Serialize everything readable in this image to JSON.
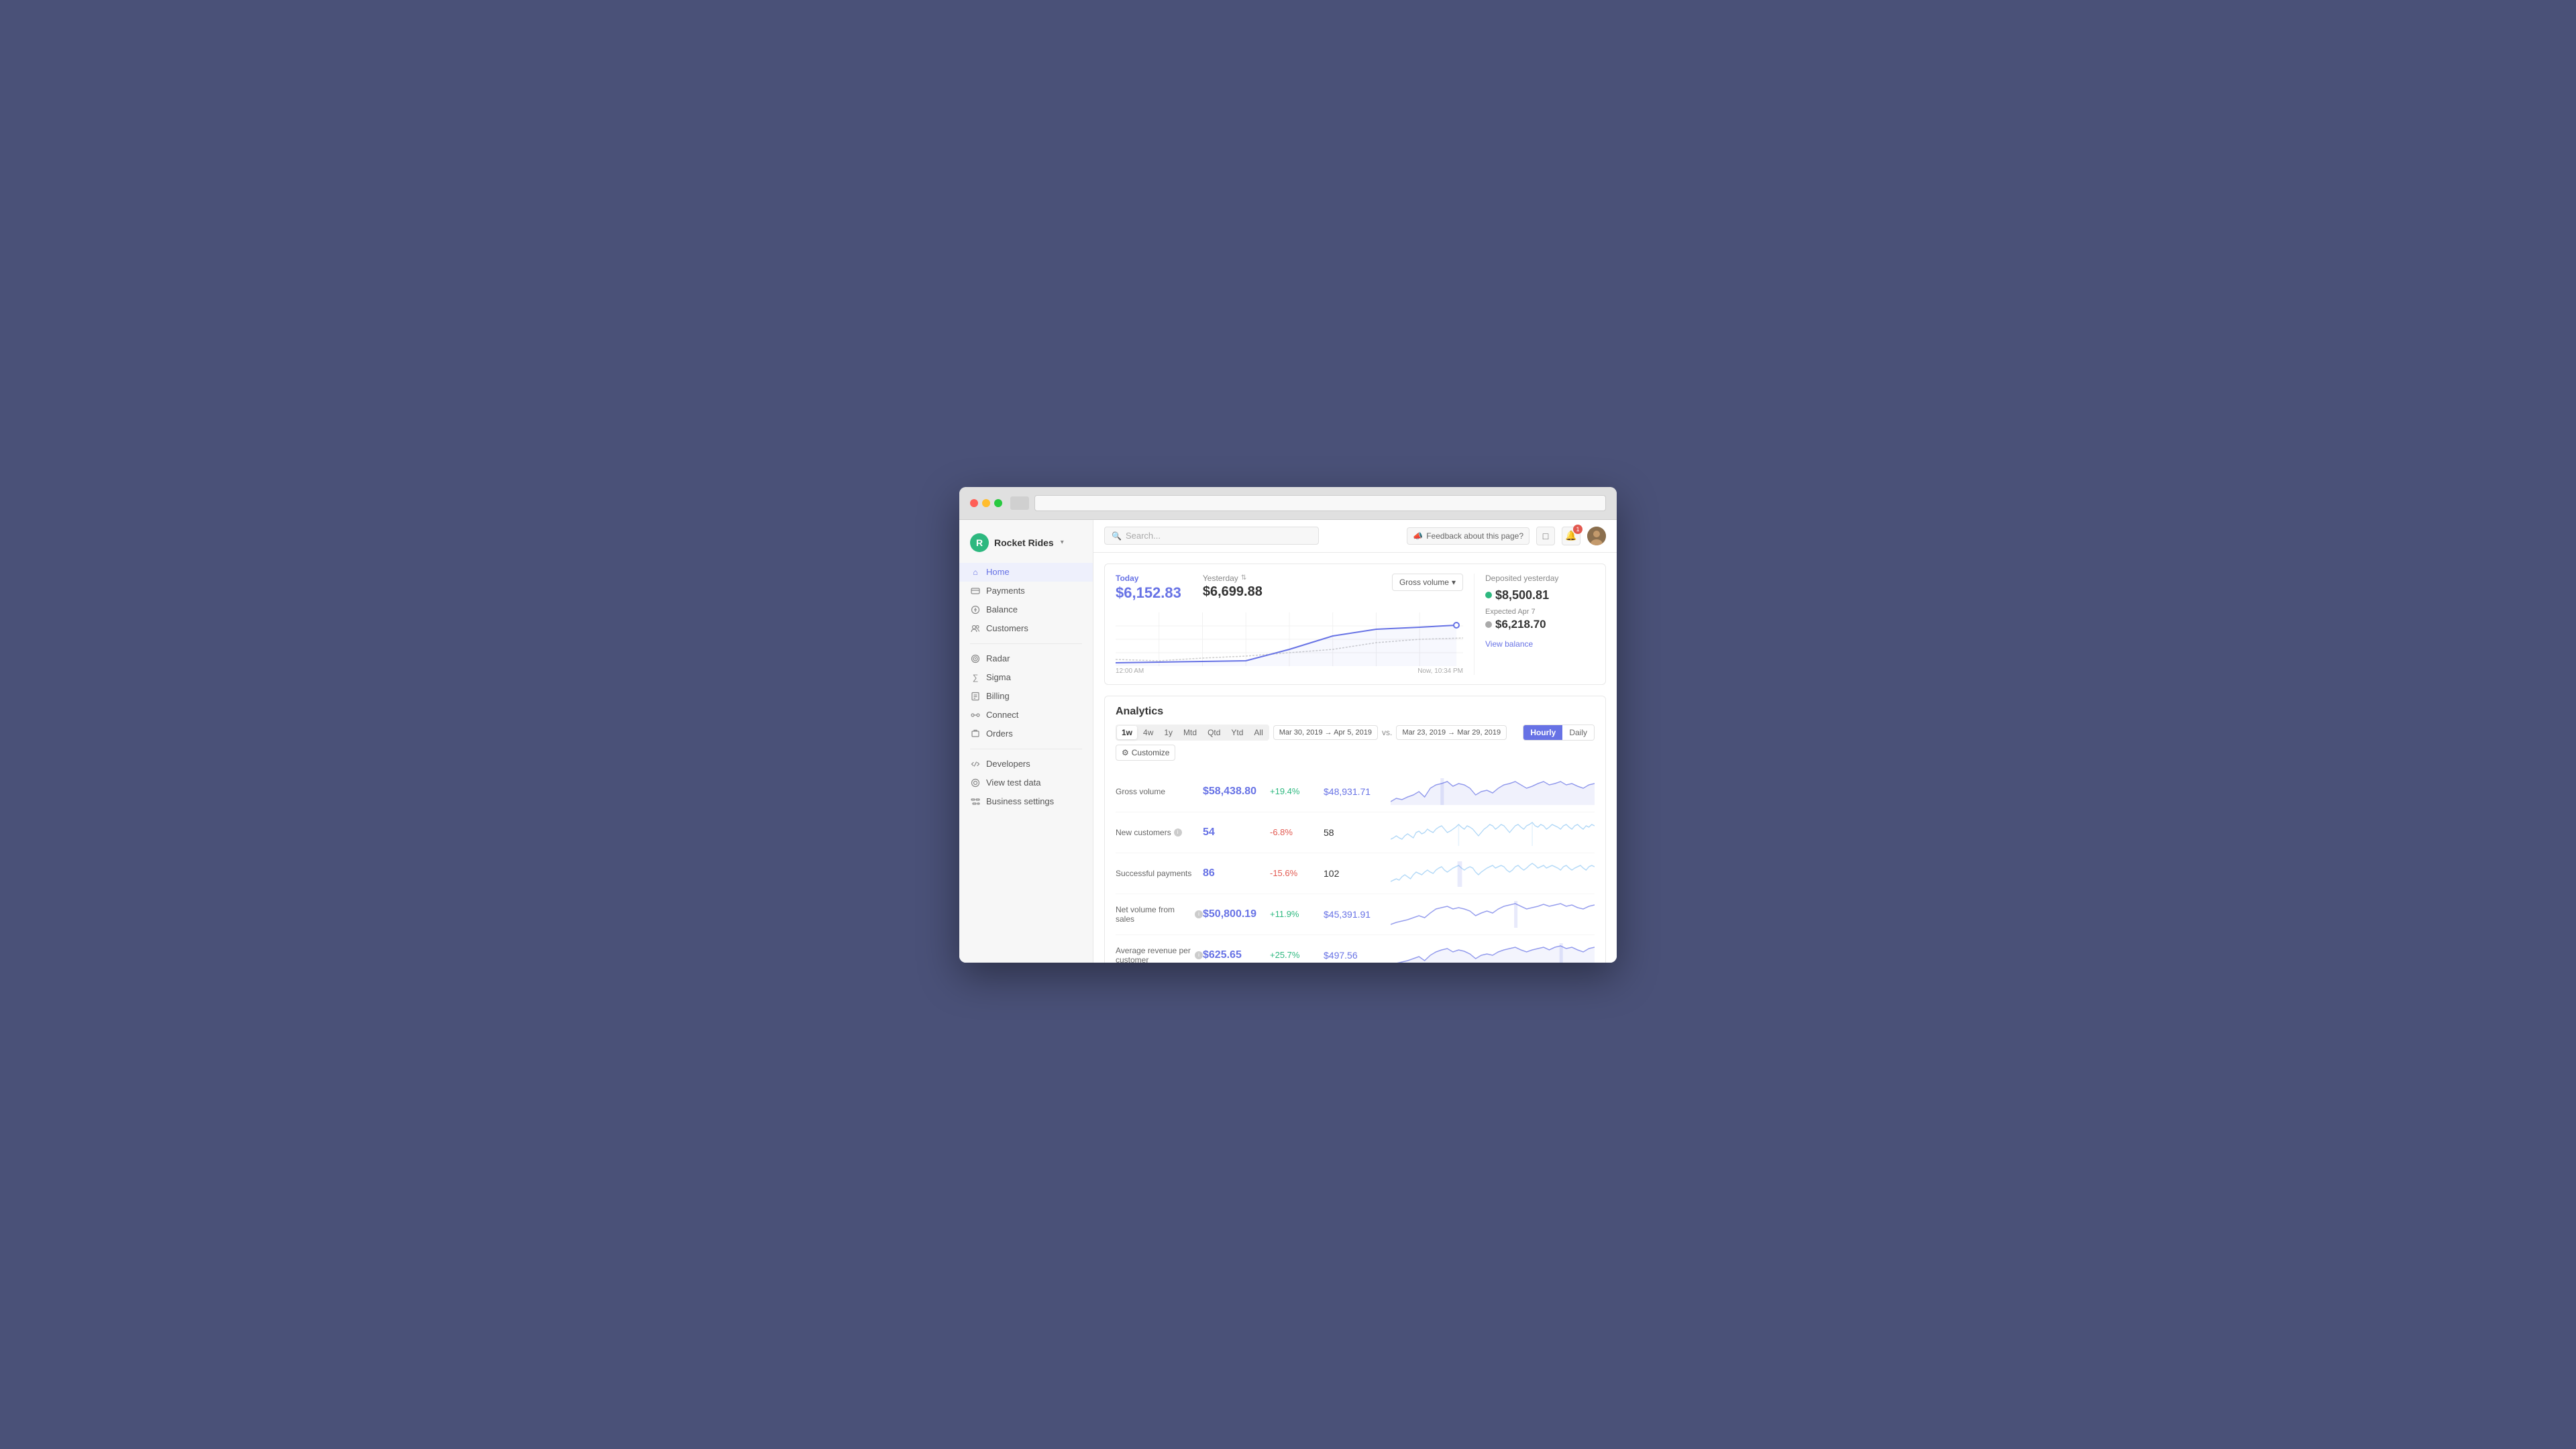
{
  "browser": {
    "traffic_lights": [
      "red",
      "yellow",
      "green"
    ]
  },
  "sidebar": {
    "brand_name": "Rocket Rides",
    "brand_chevron": "▾",
    "nav_items": [
      {
        "label": "Home",
        "icon": "🏠",
        "active": true,
        "section": "main"
      },
      {
        "label": "Payments",
        "icon": "💳",
        "active": false,
        "section": "main"
      },
      {
        "label": "Balance",
        "icon": "⚖️",
        "active": false,
        "section": "main"
      },
      {
        "label": "Customers",
        "icon": "👥",
        "active": false,
        "section": "main"
      },
      {
        "label": "Radar",
        "icon": "📡",
        "active": false,
        "section": "tools"
      },
      {
        "label": "Sigma",
        "icon": "∑",
        "active": false,
        "section": "tools"
      },
      {
        "label": "Billing",
        "icon": "📋",
        "active": false,
        "section": "tools"
      },
      {
        "label": "Connect",
        "icon": "🔗",
        "active": false,
        "section": "tools"
      },
      {
        "label": "Orders",
        "icon": "📦",
        "active": false,
        "section": "tools"
      },
      {
        "label": "Developers",
        "icon": "💻",
        "active": false,
        "section": "dev"
      },
      {
        "label": "View test data",
        "icon": "👁",
        "active": false,
        "section": "dev"
      },
      {
        "label": "Business settings",
        "icon": "⚙️",
        "active": false,
        "section": "dev"
      }
    ]
  },
  "topbar": {
    "search_placeholder": "Search...",
    "feedback_label": "Feedback about this page?",
    "notification_count": "1"
  },
  "today_section": {
    "today_label": "Today",
    "today_value": "$6,152.83",
    "yesterday_label": "Yesterday",
    "yesterday_value": "$6,699.88",
    "gross_volume_label": "Gross volume",
    "time_start": "12:00 AM",
    "time_end": "Now, 10:34 PM"
  },
  "deposit_section": {
    "title": "Deposited yesterday",
    "amount": "$8,500.81",
    "expected_label": "Expected Apr 7",
    "expected_amount": "$6,218.70",
    "view_balance_label": "View balance"
  },
  "analytics": {
    "title": "Analytics",
    "time_tabs": [
      {
        "label": "1w",
        "active": true
      },
      {
        "label": "4w",
        "active": false
      },
      {
        "label": "1y",
        "active": false
      },
      {
        "label": "Mtd",
        "active": false
      },
      {
        "label": "Qtd",
        "active": false
      },
      {
        "label": "Ytd",
        "active": false
      },
      {
        "label": "All",
        "active": false
      }
    ],
    "date_range_current": "Mar 30, 2019 → Apr 5, 2019",
    "vs_label": "vs.",
    "date_range_previous": "Mar 23, 2019 → Mar 29, 2019",
    "hourly_daily": [
      {
        "label": "Hourly",
        "active": true
      },
      {
        "label": "Daily",
        "active": false
      }
    ],
    "customize_label": "Customize",
    "metrics": [
      {
        "name": "Gross volume",
        "has_info": false,
        "current": "$58,438.80",
        "change": "+19.4%",
        "change_type": "positive",
        "previous": "$48,931.71",
        "previous_type": "blue"
      },
      {
        "name": "New customers",
        "has_info": true,
        "current": "54",
        "change": "-6.8%",
        "change_type": "negative",
        "previous": "58",
        "previous_type": "plain"
      },
      {
        "name": "Successful payments",
        "has_info": false,
        "current": "86",
        "change": "-15.6%",
        "change_type": "negative",
        "previous": "102",
        "previous_type": "plain"
      },
      {
        "name": "Net volume from sales",
        "has_info": true,
        "current": "$50,800.19",
        "change": "+11.9%",
        "change_type": "positive",
        "previous": "$45,391.91",
        "previous_type": "blue"
      },
      {
        "name": "Average revenue per customer",
        "has_info": true,
        "current": "$625.65",
        "change": "+25.7%",
        "change_type": "positive",
        "previous": "$497.56",
        "previous_type": "blue"
      }
    ]
  }
}
